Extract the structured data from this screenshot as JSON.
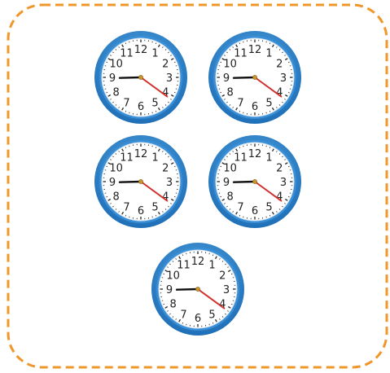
{
  "frame": {
    "border_color": "#f0962a",
    "style": "dashed"
  },
  "clocks": [
    {
      "hour_hand_at": 8.95,
      "minute_hand_at": 4.2
    },
    {
      "hour_hand_at": 8.95,
      "minute_hand_at": 4.2
    },
    {
      "hour_hand_at": 8.95,
      "minute_hand_at": 4.2
    },
    {
      "hour_hand_at": 8.95,
      "minute_hand_at": 4.2
    },
    {
      "hour_hand_at": 8.95,
      "minute_hand_at": 4.2
    }
  ],
  "dial_numbers": [
    "12",
    "1",
    "2",
    "3",
    "4",
    "5",
    "6",
    "7",
    "8",
    "9",
    "10",
    "11"
  ],
  "colors": {
    "rim_outer": "#1f6fb8",
    "rim_inner": "#5aaee8",
    "face": "#ffffff",
    "numerals": "#222222",
    "hour_hand": "#111111",
    "minute_hand": "#d0312d",
    "pivot": "#c8962a"
  }
}
